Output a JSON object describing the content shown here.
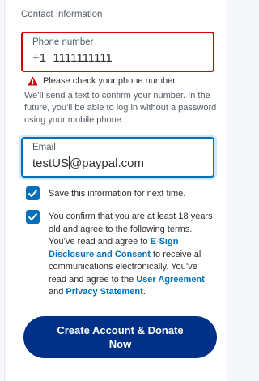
{
  "section_title": "Contact Information",
  "phone": {
    "label": "Phone number",
    "value": "+1  1111111111",
    "error": "Please check your phone number."
  },
  "helper_text": "We’ll send a text to confirm your number. In the future, you’ll be able to log in without a password using your mobile phone.",
  "email": {
    "label": "Email",
    "value_before_caret": "testUS",
    "value_after_caret": "@paypal.com"
  },
  "save_info": {
    "checked": true,
    "label": "Save this information for next time."
  },
  "agreement": {
    "checked": true,
    "text_1": "You confirm that you are at least 18 years old and agree to the following terms. You’ve read and agree to ",
    "link_esign": "E-Sign Disclosure and Consent",
    "text_2": " to receive all communications electronically. You’ve read and agree to the ",
    "link_user_agreement": "User Agreement",
    "text_3": " and ",
    "link_privacy": "Privacy Statement",
    "text_4": "."
  },
  "cta_label": "Create Account & Donate Now",
  "colors": {
    "primary_button": "#003087",
    "link": "#0070ba",
    "error": "#d20000",
    "checkbox": "#0070ba"
  }
}
